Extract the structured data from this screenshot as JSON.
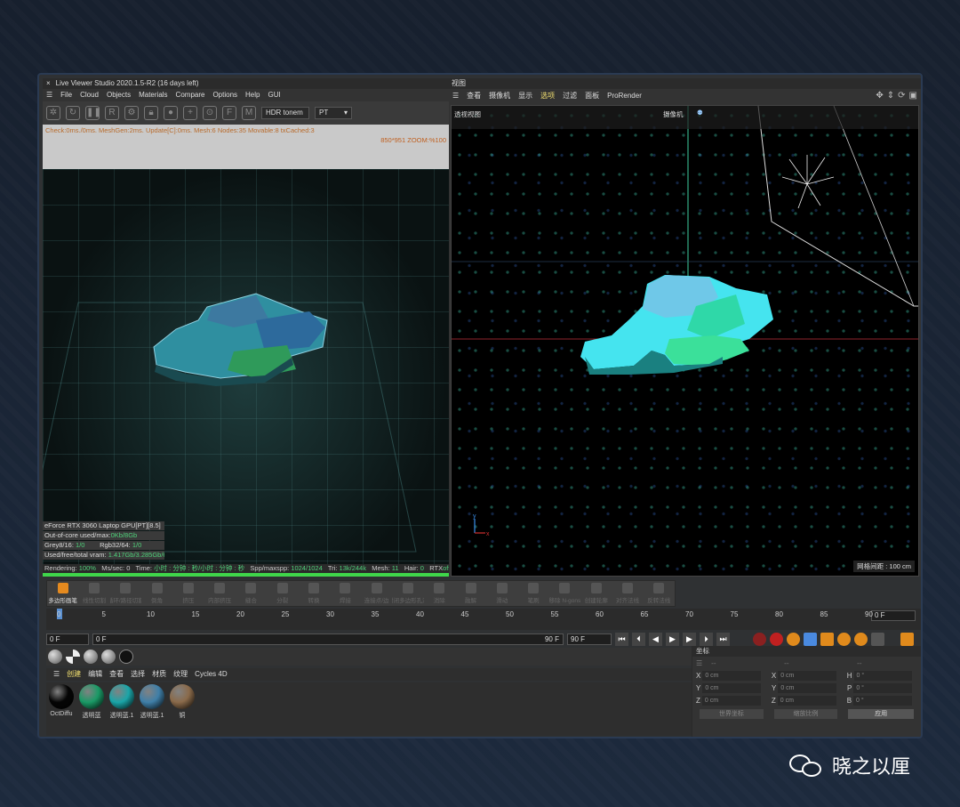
{
  "left": {
    "title": "Live Viewer Studio 2020.1.5-R2 (16 days left)",
    "close": "×",
    "menu": [
      "File",
      "Cloud",
      "Objects",
      "Materials",
      "Compare",
      "Options",
      "Help",
      "GUI"
    ],
    "hdr": "HDR tonem",
    "pt": "PT",
    "status": "Check:0ms./0ms. MeshGen:2ms. Update[C]:0ms. Mesh:6 Nodes:35 Movable:8 txCached:3",
    "zoom": "850*951 ZOOM:%100",
    "gpu": "eForce RTX 3060 Laptop GPU[PT][8.5]",
    "ooc_label": "Out-of-core used/max:",
    "ooc_val": "0Kb/8Gb",
    "grey_label": "Grey8/16:",
    "grey_val": "1/0",
    "rgb_label": "Rgb32/64:",
    "rgb_val": "1/0",
    "vram_label": "Used/free/total vram:",
    "vram_val": "1.417Gb/3.285Gb/6G",
    "bottom": {
      "rendering_l": "Rendering:",
      "rendering": "100%",
      "ms_l": "Ms/sec:",
      "ms": "0",
      "time_l": "Time:",
      "time": "小时 : 分钟 : 秒/小时 : 分钟 : 秒",
      "spp_l": "Spp/maxspp:",
      "spp": "1024/1024",
      "tri_l": "Tri:",
      "tri": "13k/244k",
      "mesh_l": "Mesh:",
      "mesh": "11",
      "hair_l": "Hair:",
      "hair": "0",
      "rtx_l": "RTX",
      "rtx": "off"
    }
  },
  "right": {
    "title": "视图",
    "menu": [
      "查看",
      "摄像机",
      "显示",
      "选项",
      "过滤",
      "面板",
      "ProRender"
    ],
    "active_menu": "选项",
    "persp": "透视视图",
    "camera": "摄像机",
    "grid_label": "网格间距 : 100 cm",
    "axis_y": "y",
    "axis_x": "x"
  },
  "toolbar": [
    {
      "label": "多边形画笔",
      "active": true
    },
    {
      "label": "线性切割"
    },
    {
      "label": "循环/路径切割"
    },
    {
      "label": "倒角"
    },
    {
      "label": "挤压"
    },
    {
      "label": "内部挤压"
    },
    {
      "label": "缝合"
    },
    {
      "label": "分裂"
    },
    {
      "label": "转换"
    },
    {
      "label": "焊接"
    },
    {
      "label": "连接点/边"
    },
    {
      "label": "封闭多边形孔洞"
    },
    {
      "label": "消除"
    },
    {
      "label": "融解"
    },
    {
      "label": "滑动"
    },
    {
      "label": "笔刷"
    },
    {
      "label": "移除 N-gons"
    },
    {
      "label": "创建轮廓"
    },
    {
      "label": "对齐法线"
    },
    {
      "label": "反转法线"
    }
  ],
  "timeline": {
    "ticks": [
      "0",
      "5",
      "10",
      "15",
      "20",
      "25",
      "30",
      "35",
      "40",
      "45",
      "50",
      "55",
      "60",
      "65",
      "70",
      "75",
      "80",
      "85",
      "90"
    ],
    "frame": "0 F",
    "start": "0 F",
    "start2": "0 F",
    "end": "90 F",
    "end2": "90 F"
  },
  "material": {
    "menu": [
      "创建",
      "编辑",
      "查看",
      "选择",
      "材质",
      "纹理",
      "Cycles 4D"
    ],
    "active": "创建",
    "items": [
      {
        "name": "OctDiffu",
        "color": "#050505"
      },
      {
        "name": "透明蓝",
        "color": "#1a9a66"
      },
      {
        "name": "透明蓝.1",
        "color": "#1aa5a8"
      },
      {
        "name": "透明蓝.1",
        "color": "#3f7fa8"
      },
      {
        "name": "铜",
        "color": "#8a6a4a"
      }
    ]
  },
  "coords": {
    "tab": "坐标",
    "rows": [
      [
        "X",
        "0 cm",
        "X",
        "0 cm",
        "H",
        "0 °"
      ],
      [
        "Y",
        "0 cm",
        "Y",
        "0 cm",
        "P",
        "0 °"
      ],
      [
        "Z",
        "0 cm",
        "Z",
        "0 cm",
        "B",
        "0 °"
      ]
    ],
    "world": "世界坐标",
    "scale": "缩放比例",
    "apply": "应用",
    "dash": "--"
  },
  "brand": {
    "name": "晓之以厘"
  }
}
